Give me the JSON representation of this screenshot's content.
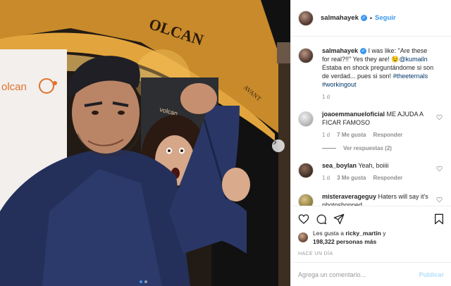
{
  "header": {
    "username": "salmahayek",
    "separator": "•",
    "follow_label": "Seguir"
  },
  "caption": {
    "username": "salmahayek",
    "text_1": " I was like: \"Are these for real?!!\" Yes they are! ",
    "emoji": "😉",
    "mention": "@kumailn",
    "text_2": " Estaba en shock preguntándome si son de verdad... pues si son! ",
    "hashtag_1": "#theeternals",
    "hashtag_2": "#workingout",
    "time": "1 d"
  },
  "comments": [
    {
      "username": "joaoemmanueloficial",
      "text": " ME AJUDA A FICAR FAMOSO",
      "time": "1 d",
      "likes": "7 Me gusta",
      "reply": "Responder",
      "view_replies": "Ver respuestas (2)"
    },
    {
      "username": "sea_boylan",
      "text": " Yeah, boiiii",
      "time": "1 d",
      "likes": "3 Me gusta",
      "reply": "Responder"
    },
    {
      "username": "misteraverageguy",
      "text": " Haters will say it's photoshopped"
    }
  ],
  "likes": {
    "prefix": "Les gusta a ",
    "user": "ricky_martin",
    "middle": " y",
    "count": "198,322 personas más"
  },
  "ago": "HACE UN DÍA",
  "add_comment": {
    "placeholder": "Agrega un comentario...",
    "publish": "Publicar"
  },
  "icons": {
    "verified": "✓",
    "like": "heart-icon",
    "comment": "comment-icon",
    "share": "share-icon",
    "save": "bookmark-icon",
    "next": "chevron-right-icon"
  },
  "photo_signage": {
    "sign_top": "OLCAN",
    "sign_left": "olcan",
    "sign_mid": "volcan",
    "sign_right": "AVANT"
  },
  "colors": {
    "accent": "#3897f0",
    "link": "#003569"
  }
}
